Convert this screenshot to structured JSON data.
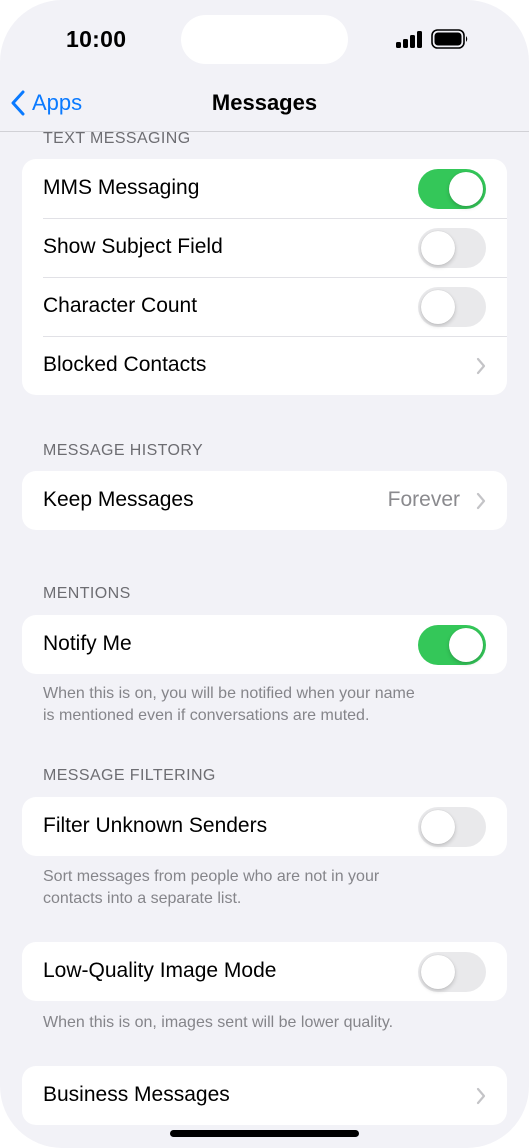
{
  "status_bar": {
    "time": "10:00"
  },
  "nav": {
    "back_label": "Apps",
    "title": "Messages"
  },
  "sections": {
    "text_messaging": {
      "header": "TEXT MESSAGING",
      "rows": [
        {
          "label": "MMS Messaging",
          "toggle": true
        },
        {
          "label": "Show Subject Field",
          "toggle": false
        },
        {
          "label": "Character Count",
          "toggle": false
        },
        {
          "label": "Blocked Contacts"
        }
      ]
    },
    "message_history": {
      "header": "MESSAGE HISTORY",
      "rows": [
        {
          "label": "Keep Messages",
          "value": "Forever"
        }
      ]
    },
    "mentions": {
      "header": "MENTIONS",
      "rows": [
        {
          "label": "Notify Me",
          "toggle": true
        }
      ],
      "footer_1": "When this is on, you will be notified when your name",
      "footer_2": "is mentioned even if conversations are muted."
    },
    "message_filtering": {
      "header": "MESSAGE FILTERING",
      "rows": [
        {
          "label": "Filter Unknown Senders",
          "toggle": false
        }
      ],
      "footer_1": "Sort messages from people who are not in your",
      "footer_2": "contacts into a separate list."
    },
    "image_mode": {
      "rows": [
        {
          "label": "Low-Quality Image Mode",
          "toggle": false
        }
      ],
      "footer": "When this is on, images sent will be lower quality."
    },
    "business": {
      "rows": [
        {
          "label": "Business Messages"
        }
      ]
    }
  },
  "colors": {
    "accent": "#0a7aff",
    "toggle_on": "#34c759",
    "toggle_off": "#e9e9eb",
    "background": "#f2f2f7"
  }
}
